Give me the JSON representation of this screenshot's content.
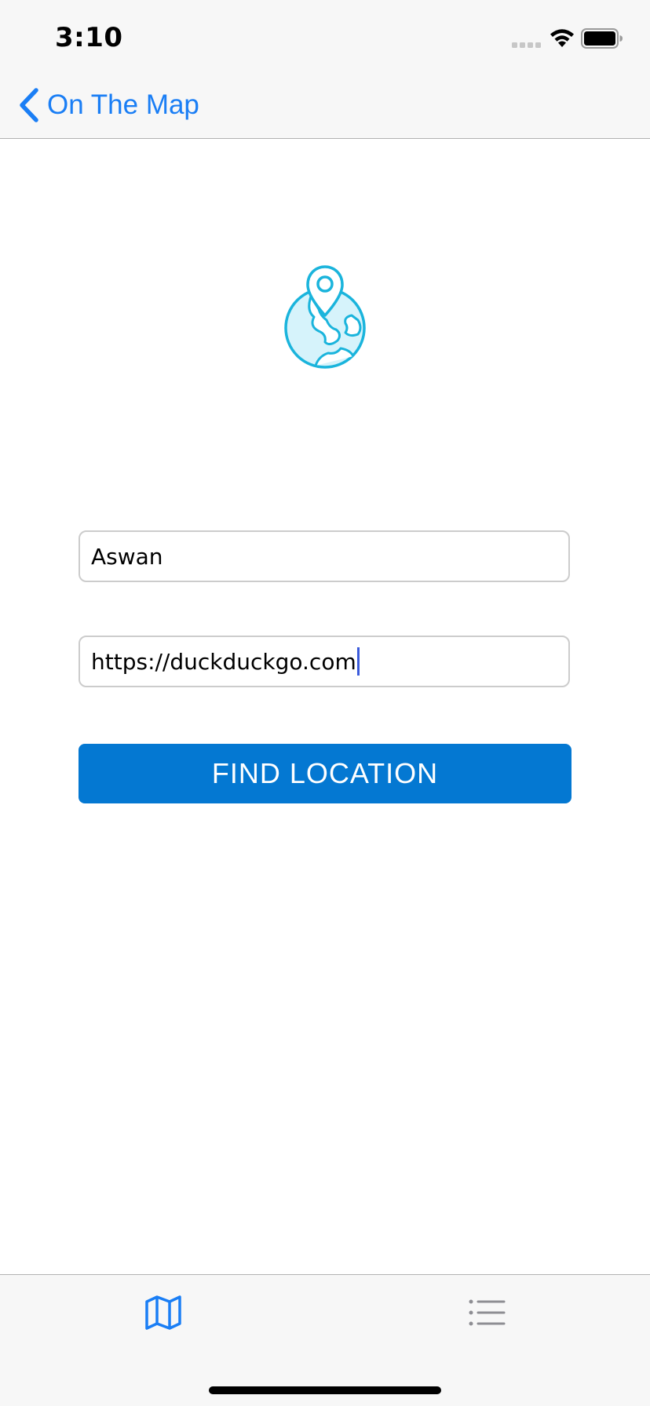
{
  "status_bar": {
    "time": "3:10",
    "icons": [
      "signal-icon",
      "wifi-icon",
      "battery-icon"
    ]
  },
  "nav": {
    "back_label": "On The Map",
    "back_icon": "chevron-left-icon"
  },
  "header_icon": "globe-location-pin-icon",
  "form": {
    "location_value": "Aswan",
    "url_value": "https://duckduckgo.com",
    "find_button_label": "FIND LOCATION"
  },
  "tab_bar": {
    "items": [
      {
        "icon": "map-icon",
        "selected": true
      },
      {
        "icon": "list-icon",
        "selected": false
      }
    ]
  },
  "colors": {
    "accent": "#1a7ef5",
    "button": "#0478d2",
    "globe": "#1ab4dc",
    "globe_fill": "#d6f3fb",
    "tab_inactive": "#8e8e93"
  }
}
